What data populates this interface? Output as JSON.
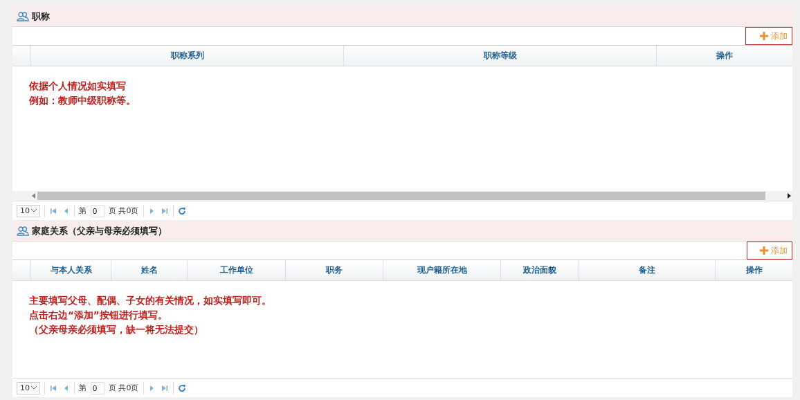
{
  "sections": [
    {
      "title": "职称",
      "add_button": "添加",
      "columns": [
        "职称系列",
        "职称等级",
        "操作"
      ],
      "notes": [
        "依据个人情况如实填写",
        "例如：教师中级职称等。"
      ],
      "horizontal_scrollbar": true,
      "pager": {
        "page_size": "10",
        "page_prefix": "第",
        "page": "0",
        "page_suffix": "页 共0页"
      }
    },
    {
      "title": "家庭关系（父亲与母亲必须填写）",
      "add_button": "添加",
      "columns": [
        "与本人关系",
        "姓名",
        "工作单位",
        "职务",
        "现户籍所在地",
        "政治面貌",
        "备注",
        "操作"
      ],
      "notes": [
        "主要填写父母、配偶、子女的有关情况，如实填写即可。",
        "点击右边“添加”按钮进行填写。",
        "（父亲母亲必须填写，缺一将无法提交）"
      ],
      "horizontal_scrollbar": false,
      "pager": {
        "page_size": "10",
        "page_prefix": "第",
        "page": "0",
        "page_suffix": "页 共0页"
      }
    }
  ]
}
